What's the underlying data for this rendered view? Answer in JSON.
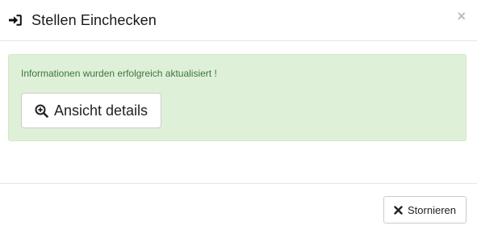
{
  "modal": {
    "title": "Stellen Einchecken",
    "title_icon": "sign-in-icon",
    "close_label": "×"
  },
  "alert": {
    "message": "Informationen wurden erfolgreich aktualisiert !",
    "background_color": "#dff0d8",
    "text_color": "#3c763d",
    "details_button": {
      "label": "Ansicht details",
      "icon": "zoom-in-icon"
    }
  },
  "footer": {
    "cancel_button": {
      "label": "Stornieren",
      "icon": "close-icon"
    }
  }
}
